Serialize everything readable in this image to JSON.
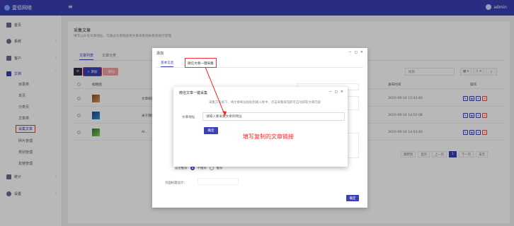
{
  "topbar": {
    "brand": "壹佰网络",
    "menu_icon": "hamburger-icon",
    "user": "admin"
  },
  "sidebar": {
    "items": [
      {
        "label": "首页",
        "icon": "home-icon"
      },
      {
        "label": "系统",
        "icon": "settings-icon"
      },
      {
        "label": "客户",
        "icon": "user-icon"
      },
      {
        "label": "文档",
        "icon": "grid-icon"
      }
    ],
    "sub_items": [
      "目录类",
      "单页",
      "分类页",
      "文章类",
      "采集文章",
      "碎片管理",
      "类别管理",
      "友链管理"
    ],
    "active_sub": "采集文章",
    "bottom_items": [
      {
        "label": "统计",
        "icon": "chart-icon"
      },
      {
        "label": "设置",
        "icon": "gear-icon"
      }
    ]
  },
  "page": {
    "title": "采集文章",
    "description": "填写公众号文章地址，可通过文章链接将文章采集到本系统进行管理",
    "tabs": [
      "文章列表",
      "文章分类"
    ],
    "toolbar": {
      "add": "+ 添加",
      "delete": "- 删除"
    },
    "search_placeholder": "搜索",
    "table_headers": [
      "缩略图",
      "标题",
      "发布时间",
      "操作"
    ],
    "rows": [
      {
        "title": "文章标题…",
        "time": "2020-09-14 15:43:40"
      },
      {
        "title": "关于我们…",
        "time": "2020-09-14 14:50:08"
      },
      {
        "title": "AI…",
        "time": "2020-09-14 14:03:40"
      }
    ],
    "pager": {
      "goto": "跳转到",
      "first": "首页",
      "prev": "上一页",
      "current": "1",
      "next": "下一页",
      "last": "末页"
    }
  },
  "dialog": {
    "title": "添加",
    "tabs": {
      "basic": "基本信息",
      "collect": "微信文章一键采集"
    },
    "recommend_label": "是否推荐",
    "radio_options": [
      "不推荐",
      "推荐"
    ],
    "selected_radio": "不推荐",
    "field_label": "页面标题设计：",
    "submit": "确定"
  },
  "inner_dialog": {
    "title": "微信文章一键采集",
    "note": "采集方法如下，将文章网址粘贴到输入框中，点击采集按钮即可自动获取文章内容",
    "label": "文章地址",
    "placeholder": "请输入要采集文章的网址",
    "button": "确定"
  },
  "annotation": "填写复制的文章链接",
  "colors": {
    "primary": "#3a3fb5",
    "highlight": "#ff2d2d"
  }
}
